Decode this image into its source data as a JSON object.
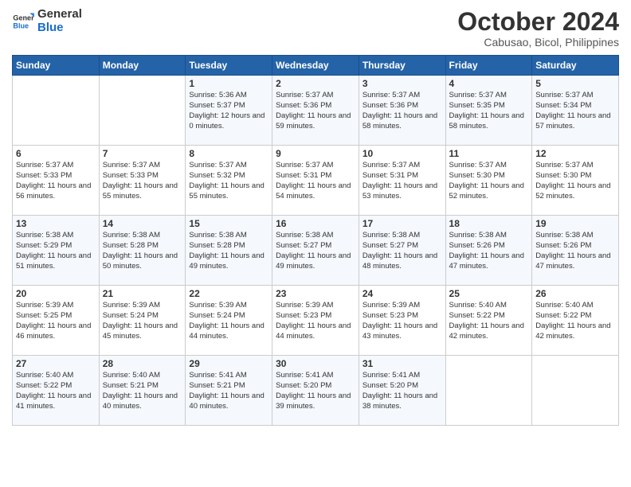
{
  "header": {
    "logo_general": "General",
    "logo_blue": "Blue",
    "month_year": "October 2024",
    "location": "Cabusao, Bicol, Philippines"
  },
  "days_of_week": [
    "Sunday",
    "Monday",
    "Tuesday",
    "Wednesday",
    "Thursday",
    "Friday",
    "Saturday"
  ],
  "weeks": [
    [
      {
        "day": "",
        "content": ""
      },
      {
        "day": "",
        "content": ""
      },
      {
        "day": "1",
        "content": "Sunrise: 5:36 AM\nSunset: 5:37 PM\nDaylight: 12 hours\nand 0 minutes."
      },
      {
        "day": "2",
        "content": "Sunrise: 5:37 AM\nSunset: 5:36 PM\nDaylight: 11 hours\nand 59 minutes."
      },
      {
        "day": "3",
        "content": "Sunrise: 5:37 AM\nSunset: 5:36 PM\nDaylight: 11 hours\nand 58 minutes."
      },
      {
        "day": "4",
        "content": "Sunrise: 5:37 AM\nSunset: 5:35 PM\nDaylight: 11 hours\nand 58 minutes."
      },
      {
        "day": "5",
        "content": "Sunrise: 5:37 AM\nSunset: 5:34 PM\nDaylight: 11 hours\nand 57 minutes."
      }
    ],
    [
      {
        "day": "6",
        "content": "Sunrise: 5:37 AM\nSunset: 5:33 PM\nDaylight: 11 hours\nand 56 minutes."
      },
      {
        "day": "7",
        "content": "Sunrise: 5:37 AM\nSunset: 5:33 PM\nDaylight: 11 hours\nand 55 minutes."
      },
      {
        "day": "8",
        "content": "Sunrise: 5:37 AM\nSunset: 5:32 PM\nDaylight: 11 hours\nand 55 minutes."
      },
      {
        "day": "9",
        "content": "Sunrise: 5:37 AM\nSunset: 5:31 PM\nDaylight: 11 hours\nand 54 minutes."
      },
      {
        "day": "10",
        "content": "Sunrise: 5:37 AM\nSunset: 5:31 PM\nDaylight: 11 hours\nand 53 minutes."
      },
      {
        "day": "11",
        "content": "Sunrise: 5:37 AM\nSunset: 5:30 PM\nDaylight: 11 hours\nand 52 minutes."
      },
      {
        "day": "12",
        "content": "Sunrise: 5:37 AM\nSunset: 5:30 PM\nDaylight: 11 hours\nand 52 minutes."
      }
    ],
    [
      {
        "day": "13",
        "content": "Sunrise: 5:38 AM\nSunset: 5:29 PM\nDaylight: 11 hours\nand 51 minutes."
      },
      {
        "day": "14",
        "content": "Sunrise: 5:38 AM\nSunset: 5:28 PM\nDaylight: 11 hours\nand 50 minutes."
      },
      {
        "day": "15",
        "content": "Sunrise: 5:38 AM\nSunset: 5:28 PM\nDaylight: 11 hours\nand 49 minutes."
      },
      {
        "day": "16",
        "content": "Sunrise: 5:38 AM\nSunset: 5:27 PM\nDaylight: 11 hours\nand 49 minutes."
      },
      {
        "day": "17",
        "content": "Sunrise: 5:38 AM\nSunset: 5:27 PM\nDaylight: 11 hours\nand 48 minutes."
      },
      {
        "day": "18",
        "content": "Sunrise: 5:38 AM\nSunset: 5:26 PM\nDaylight: 11 hours\nand 47 minutes."
      },
      {
        "day": "19",
        "content": "Sunrise: 5:38 AM\nSunset: 5:26 PM\nDaylight: 11 hours\nand 47 minutes."
      }
    ],
    [
      {
        "day": "20",
        "content": "Sunrise: 5:39 AM\nSunset: 5:25 PM\nDaylight: 11 hours\nand 46 minutes."
      },
      {
        "day": "21",
        "content": "Sunrise: 5:39 AM\nSunset: 5:24 PM\nDaylight: 11 hours\nand 45 minutes."
      },
      {
        "day": "22",
        "content": "Sunrise: 5:39 AM\nSunset: 5:24 PM\nDaylight: 11 hours\nand 44 minutes."
      },
      {
        "day": "23",
        "content": "Sunrise: 5:39 AM\nSunset: 5:23 PM\nDaylight: 11 hours\nand 44 minutes."
      },
      {
        "day": "24",
        "content": "Sunrise: 5:39 AM\nSunset: 5:23 PM\nDaylight: 11 hours\nand 43 minutes."
      },
      {
        "day": "25",
        "content": "Sunrise: 5:40 AM\nSunset: 5:22 PM\nDaylight: 11 hours\nand 42 minutes."
      },
      {
        "day": "26",
        "content": "Sunrise: 5:40 AM\nSunset: 5:22 PM\nDaylight: 11 hours\nand 42 minutes."
      }
    ],
    [
      {
        "day": "27",
        "content": "Sunrise: 5:40 AM\nSunset: 5:22 PM\nDaylight: 11 hours\nand 41 minutes."
      },
      {
        "day": "28",
        "content": "Sunrise: 5:40 AM\nSunset: 5:21 PM\nDaylight: 11 hours\nand 40 minutes."
      },
      {
        "day": "29",
        "content": "Sunrise: 5:41 AM\nSunset: 5:21 PM\nDaylight: 11 hours\nand 40 minutes."
      },
      {
        "day": "30",
        "content": "Sunrise: 5:41 AM\nSunset: 5:20 PM\nDaylight: 11 hours\nand 39 minutes."
      },
      {
        "day": "31",
        "content": "Sunrise: 5:41 AM\nSunset: 5:20 PM\nDaylight: 11 hours\nand 38 minutes."
      },
      {
        "day": "",
        "content": ""
      },
      {
        "day": "",
        "content": ""
      }
    ]
  ]
}
